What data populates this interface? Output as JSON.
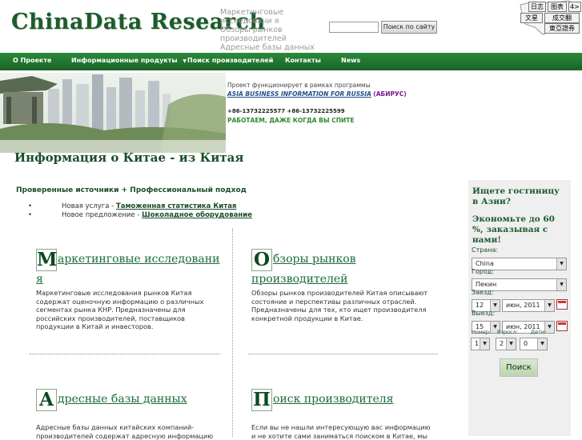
{
  "header": {
    "logo": "ChinaData Research",
    "tagline": [
      "Маркетинговые исследовани я",
      "Обзоры рынков производителей",
      "Адресные базы данных"
    ],
    "search_button": "Поиск по сайту",
    "languages": [
      "日志",
      "图表",
      "4>",
      "文星",
      "成交翻",
      "東亞證券"
    ]
  },
  "nav": {
    "items": [
      "О Проекте",
      "Информационные продукты",
      "Поиск производителей",
      "Контакты",
      "News"
    ],
    "dropdown_marker": "▼"
  },
  "banner": {
    "program_text": "Проект функционирует в рамках программы",
    "program_link": "ASIA BUSINESS INFORMATION FOR RUSSIA",
    "program_suffix": "(АБИРУС)",
    "phones": "+86-13732225577  +86-13732225599",
    "slogan": "РАБОТАЕМ, ДАЖЕ КОГДА ВЫ СПИТЕ"
  },
  "main": {
    "title": "Информация о Китае - из Китая",
    "intro": "Проверенные источники + Профессиональный подход",
    "bullets": [
      {
        "dot": "•",
        "text": "Новая услуга - ",
        "link": "Таможенная статистика Китая"
      },
      {
        "dot": "•",
        "text": "Новое предложение - ",
        "link": "Шоколадное оборудование"
      }
    ],
    "sections": [
      {
        "cap": "M",
        "title_line1": "аркетинговые исследовани",
        "title_line2": "я",
        "body": "Маркетинговые исследования рынков Китая содержат оценочную информацию о различных сегментах рынка КНР. Предназначены для российских производителей,  поставщиков продукции в Китай и инвесторов."
      },
      {
        "cap": "O",
        "title_line1": "бзоры рынков",
        "title_line2": "производителей",
        "body": "Обзоры рынков производителей Китая описывают состояние и перспективы различных отраслей. Предназначены для тех, кто ищет производителя конкретной продукции в Китае."
      },
      {
        "cap": "A",
        "title_line1": "дресные базы данных",
        "body": "Адресные базы данных китайских компаний-производителей содержат адресную информацию"
      },
      {
        "cap": "П",
        "title_line1": "оиск производителя",
        "body": "Если вы не нашли интересующую вас информацию и не хотите сами заниматься поиском в Китае, мы"
      }
    ]
  },
  "sidebar": {
    "heading": "Ищете гостиницу в Азии?",
    "promo": "Экономьте до 60 %, заказывая с нами!",
    "country_label": "Страна:",
    "country_value": "China",
    "city_label": "Город:",
    "city_value": "Пекин",
    "checkin_label": "Заезд:",
    "checkin_day": "12",
    "checkin_month": "июн, 2011",
    "checkout_label": "Выезд:",
    "checkout_day": "15",
    "checkout_month": "июн, 2011",
    "rooms_label": "Номер:",
    "adults_label": "Взросл:",
    "children_label": "Дети:",
    "rooms": "1",
    "adults": "2",
    "children": "0",
    "search_button": "Поиск"
  }
}
